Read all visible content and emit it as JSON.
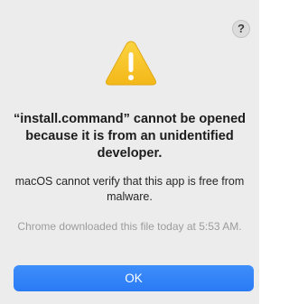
{
  "dialog": {
    "help_label": "?",
    "title": "“install.command” cannot be opened because it is from an unidentified developer.",
    "message": "macOS cannot verify that this app is free from malware.",
    "info": "Chrome downloaded this file today at 5:53 AM.",
    "ok_label": "OK",
    "icon": "warning-icon",
    "colors": {
      "background": "#ececec",
      "accent": "#2f80f7",
      "warning_yellow": "#f7c325"
    }
  }
}
